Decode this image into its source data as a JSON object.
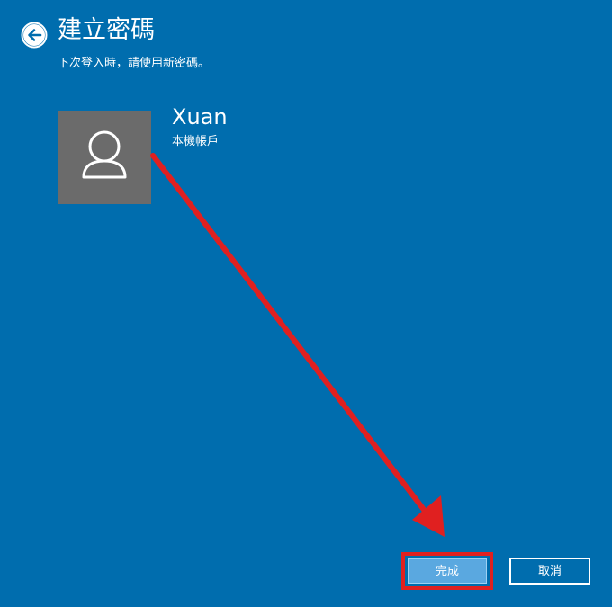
{
  "header": {
    "title": "建立密碼",
    "subtitle": "下次登入時，請使用新密碼。",
    "back_icon": "back-arrow-circle-icon"
  },
  "account": {
    "name": "Xuan",
    "type": "本機帳戶",
    "avatar_icon": "user-silhouette-icon"
  },
  "actions": {
    "finish_label": "完成",
    "cancel_label": "取消"
  },
  "annotation": {
    "arrow_color": "#e02020",
    "highlight_color": "#e02020"
  },
  "colors": {
    "background": "#006dae",
    "avatar_bg": "#6b6b6b",
    "primary_button": "#5aa8e0"
  }
}
